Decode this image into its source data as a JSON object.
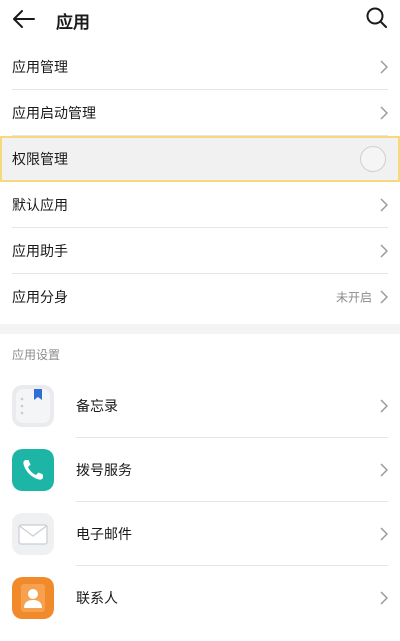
{
  "header": {
    "title": "应用",
    "back_icon": "back-arrow-icon",
    "search_icon": "search-icon"
  },
  "menu": {
    "items": [
      {
        "label": "应用管理",
        "value": ""
      },
      {
        "label": "应用启动管理",
        "value": ""
      },
      {
        "label": "权限管理",
        "value": ""
      },
      {
        "label": "默认应用",
        "value": ""
      },
      {
        "label": "应用助手",
        "value": ""
      },
      {
        "label": "应用分身",
        "value": "未开启"
      }
    ]
  },
  "app_settings": {
    "title": "应用设置",
    "items": [
      {
        "label": "备忘录",
        "icon": "notepad-icon"
      },
      {
        "label": "拨号服务",
        "icon": "phone-icon"
      },
      {
        "label": "电子邮件",
        "icon": "email-icon"
      },
      {
        "label": "联系人",
        "icon": "contacts-icon"
      }
    ]
  },
  "colors": {
    "highlight_border": "#f5d97a",
    "phone_green": "#1db6a6",
    "contacts_orange": "#f08a2b"
  }
}
